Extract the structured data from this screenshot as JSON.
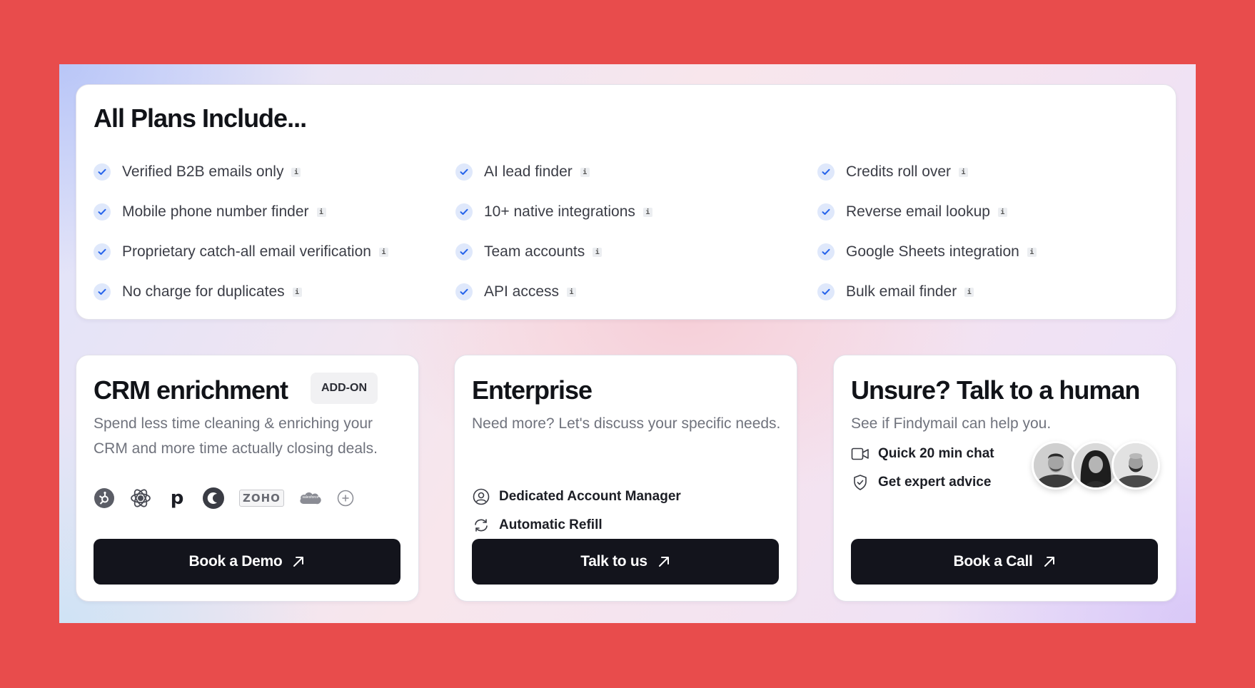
{
  "plans": {
    "title": "All Plans Include...",
    "columns": [
      [
        "Verified B2B emails only",
        "Mobile phone number finder",
        "Proprietary catch-all email verification",
        "No charge for duplicates"
      ],
      [
        "AI lead finder",
        "10+ native integrations",
        "Team accounts",
        "API access"
      ],
      [
        "Credits roll over",
        "Reverse email lookup",
        "Google Sheets integration",
        "Bulk email finder"
      ]
    ],
    "info_glyph": "i"
  },
  "crm": {
    "title": "CRM enrichment",
    "badge": "ADD-ON",
    "description": "Spend less time cleaning & enriching your CRM and more time actually closing deals.",
    "logos": [
      "hubspot-logo",
      "copper-logo",
      "pipedrive-logo",
      "close-logo",
      "zoho-logo",
      "salesforce-logo",
      "add-more-icon"
    ],
    "logo_text": {
      "pipedrive": "p",
      "zoho": "ZOHO",
      "salesforce": "salesforce"
    },
    "cta": "Book a Demo"
  },
  "enterprise": {
    "title": "Enterprise",
    "description": "Need more? Let's discuss your specific needs.",
    "items": [
      {
        "icon": "user-circle-icon",
        "label": "Dedicated Account Manager"
      },
      {
        "icon": "refresh-icon",
        "label": "Automatic Refill"
      }
    ],
    "cta": "Talk to us"
  },
  "human": {
    "title": "Unsure? Talk to a human",
    "description": "See if Findymail can help you.",
    "items": [
      {
        "icon": "video-icon",
        "label": "Quick 20 min chat"
      },
      {
        "icon": "shield-check-icon",
        "label": "Get expert advice"
      }
    ],
    "cta": "Book a Call"
  },
  "colors": {
    "background": "#e84c4c",
    "button": "#13141c",
    "check_bg": "#dfe8fb",
    "check_mark": "#2563eb"
  }
}
